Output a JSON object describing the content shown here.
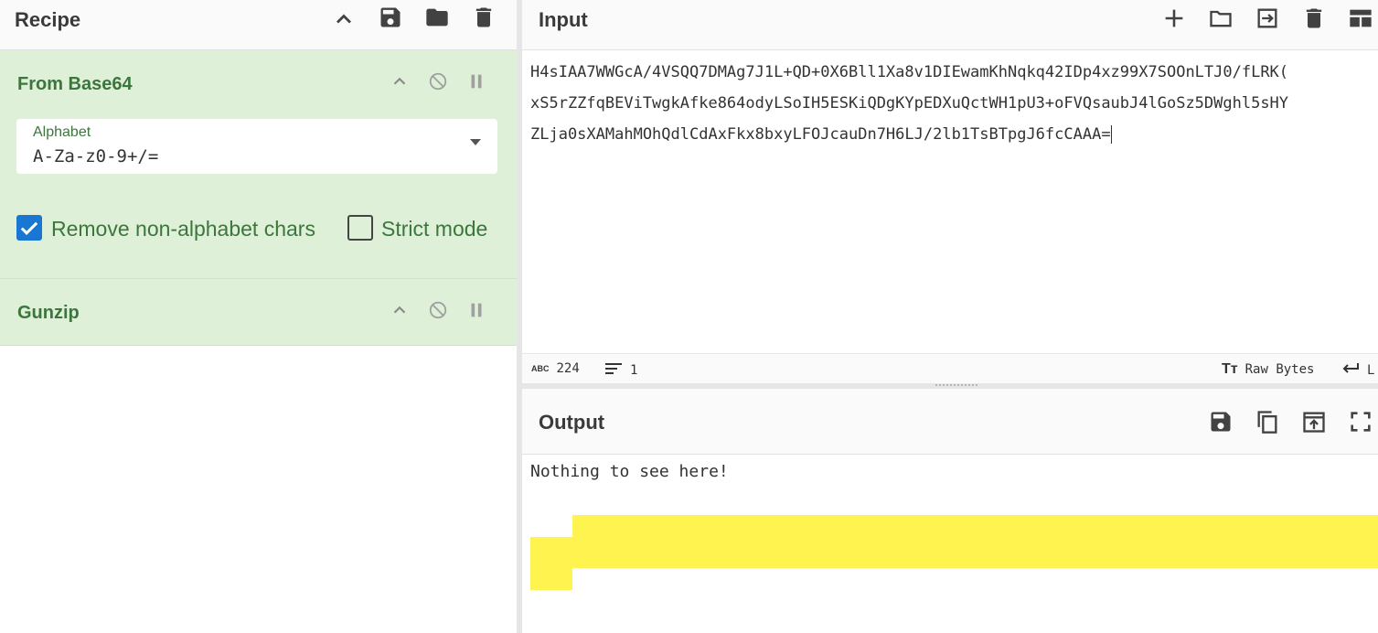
{
  "recipe": {
    "title": "Recipe",
    "icons": [
      "chevron-up-icon",
      "save-icon",
      "folder-icon",
      "trash-icon"
    ],
    "operations": [
      {
        "name": "From Base64",
        "args": {
          "alphabet_label": "Alphabet",
          "alphabet_value": "A-Za-z0-9+/=",
          "remove_non_alphabet_label": "Remove non-alphabet chars",
          "remove_non_alphabet_checked": true,
          "strict_mode_label": "Strict mode",
          "strict_mode_checked": false
        }
      },
      {
        "name": "Gunzip"
      }
    ]
  },
  "input": {
    "title": "Input",
    "lines": [
      "H4sIAA7WWGcA/4VSQQ7DMAg7J1L+QD+0X6Bll1Xa8v1DIEwamKhNqkq42IDp4xz99X7SOOnLTJ0/fLRK(",
      "xS5rZZfqBEViTwgkAfke864odyLSoIH5ESKiQDgKYpEDXuQctWH1pU3+oFVQsaubJ4lGoSz5DWghl5sHY",
      "ZLja0sXAMahMOhQdlCdAxFkx8bxyLFOJcauDn7H6LJ/2lb1TsBTpgJ6fcCAAA="
    ],
    "status": {
      "length": "224",
      "lines": "1",
      "encoding": "Raw Bytes",
      "eol": "L"
    }
  },
  "output": {
    "title": "Output",
    "text": "Nothing to see here!"
  },
  "colors": {
    "op_background": "#dff0d8",
    "op_text": "#3c763d",
    "checkbox_accent": "#1976d2",
    "highlight": "#fff350"
  }
}
